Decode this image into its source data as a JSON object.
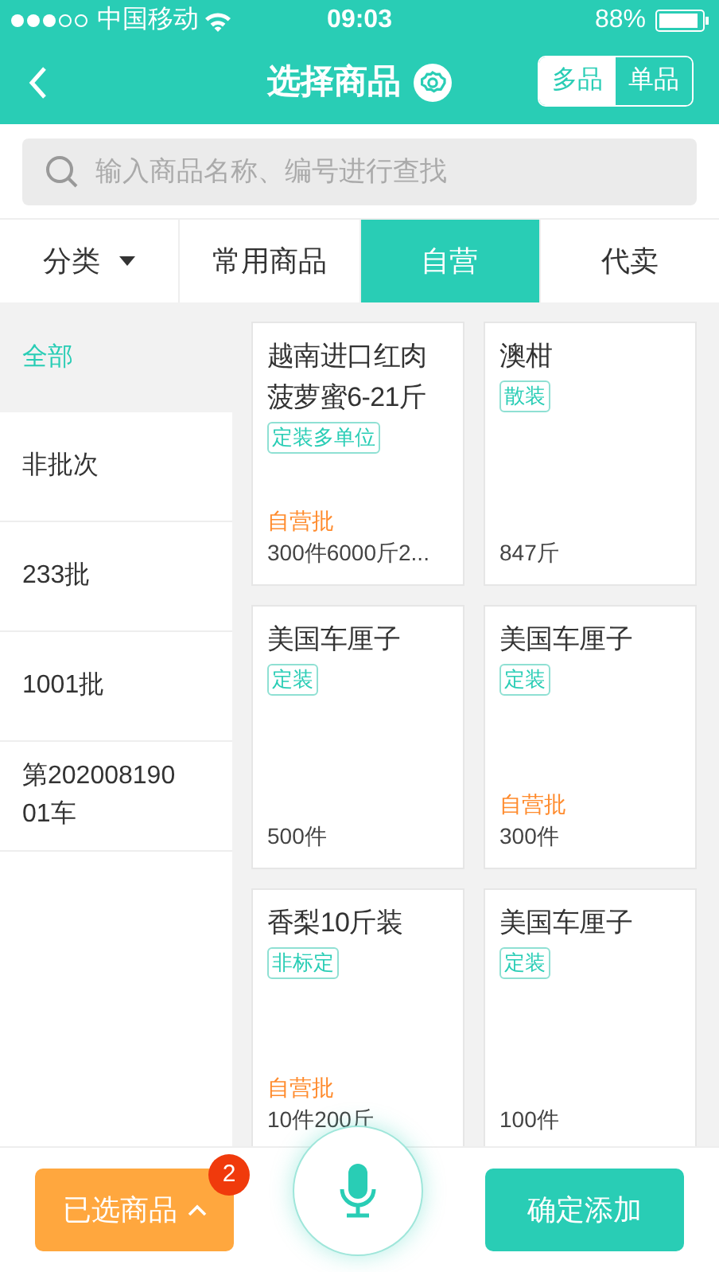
{
  "status_bar": {
    "carrier": "中国移动",
    "time": "09:03",
    "battery": "88%"
  },
  "nav": {
    "title": "选择商品",
    "modes": [
      {
        "label": "多品",
        "selected": true
      },
      {
        "label": "单品",
        "selected": false
      }
    ]
  },
  "search": {
    "placeholder": "输入商品名称、编号进行查找"
  },
  "tabs": [
    {
      "label": "分类",
      "kind": "dropdown",
      "selected": false
    },
    {
      "label": "常用商品",
      "kind": "tab",
      "selected": false
    },
    {
      "label": "自营",
      "kind": "tab",
      "selected": true
    },
    {
      "label": "代卖",
      "kind": "tab",
      "selected": false
    }
  ],
  "categories": [
    {
      "label": "全部",
      "selected": true
    },
    {
      "label": "非批次",
      "selected": false
    },
    {
      "label": "233批",
      "selected": false
    },
    {
      "label": "1001批",
      "selected": false
    },
    {
      "label": "第20200819001车",
      "selected": false
    }
  ],
  "products": [
    {
      "name": "越南进口红肉菠萝蜜6-21斤",
      "tag": "定装多单位",
      "batch": "自营批",
      "quantity": "300件6000斤2..."
    },
    {
      "name": "澳柑",
      "tag": "散装",
      "quantity": "847斤"
    },
    {
      "name": "美国车厘子",
      "tag": "定装",
      "quantity": "500件"
    },
    {
      "name": "美国车厘子",
      "tag": "定装",
      "batch": "自营批",
      "quantity": "300件"
    },
    {
      "name": "香梨10斤装",
      "tag": "非标定",
      "batch": "自营批",
      "quantity": "10件200斤"
    },
    {
      "name": "美国车厘子",
      "tag": "定装",
      "quantity": "100件"
    }
  ],
  "bottom_bar": {
    "selected_button": "已选商品",
    "badge": "2",
    "confirm_button": "确定添加"
  }
}
